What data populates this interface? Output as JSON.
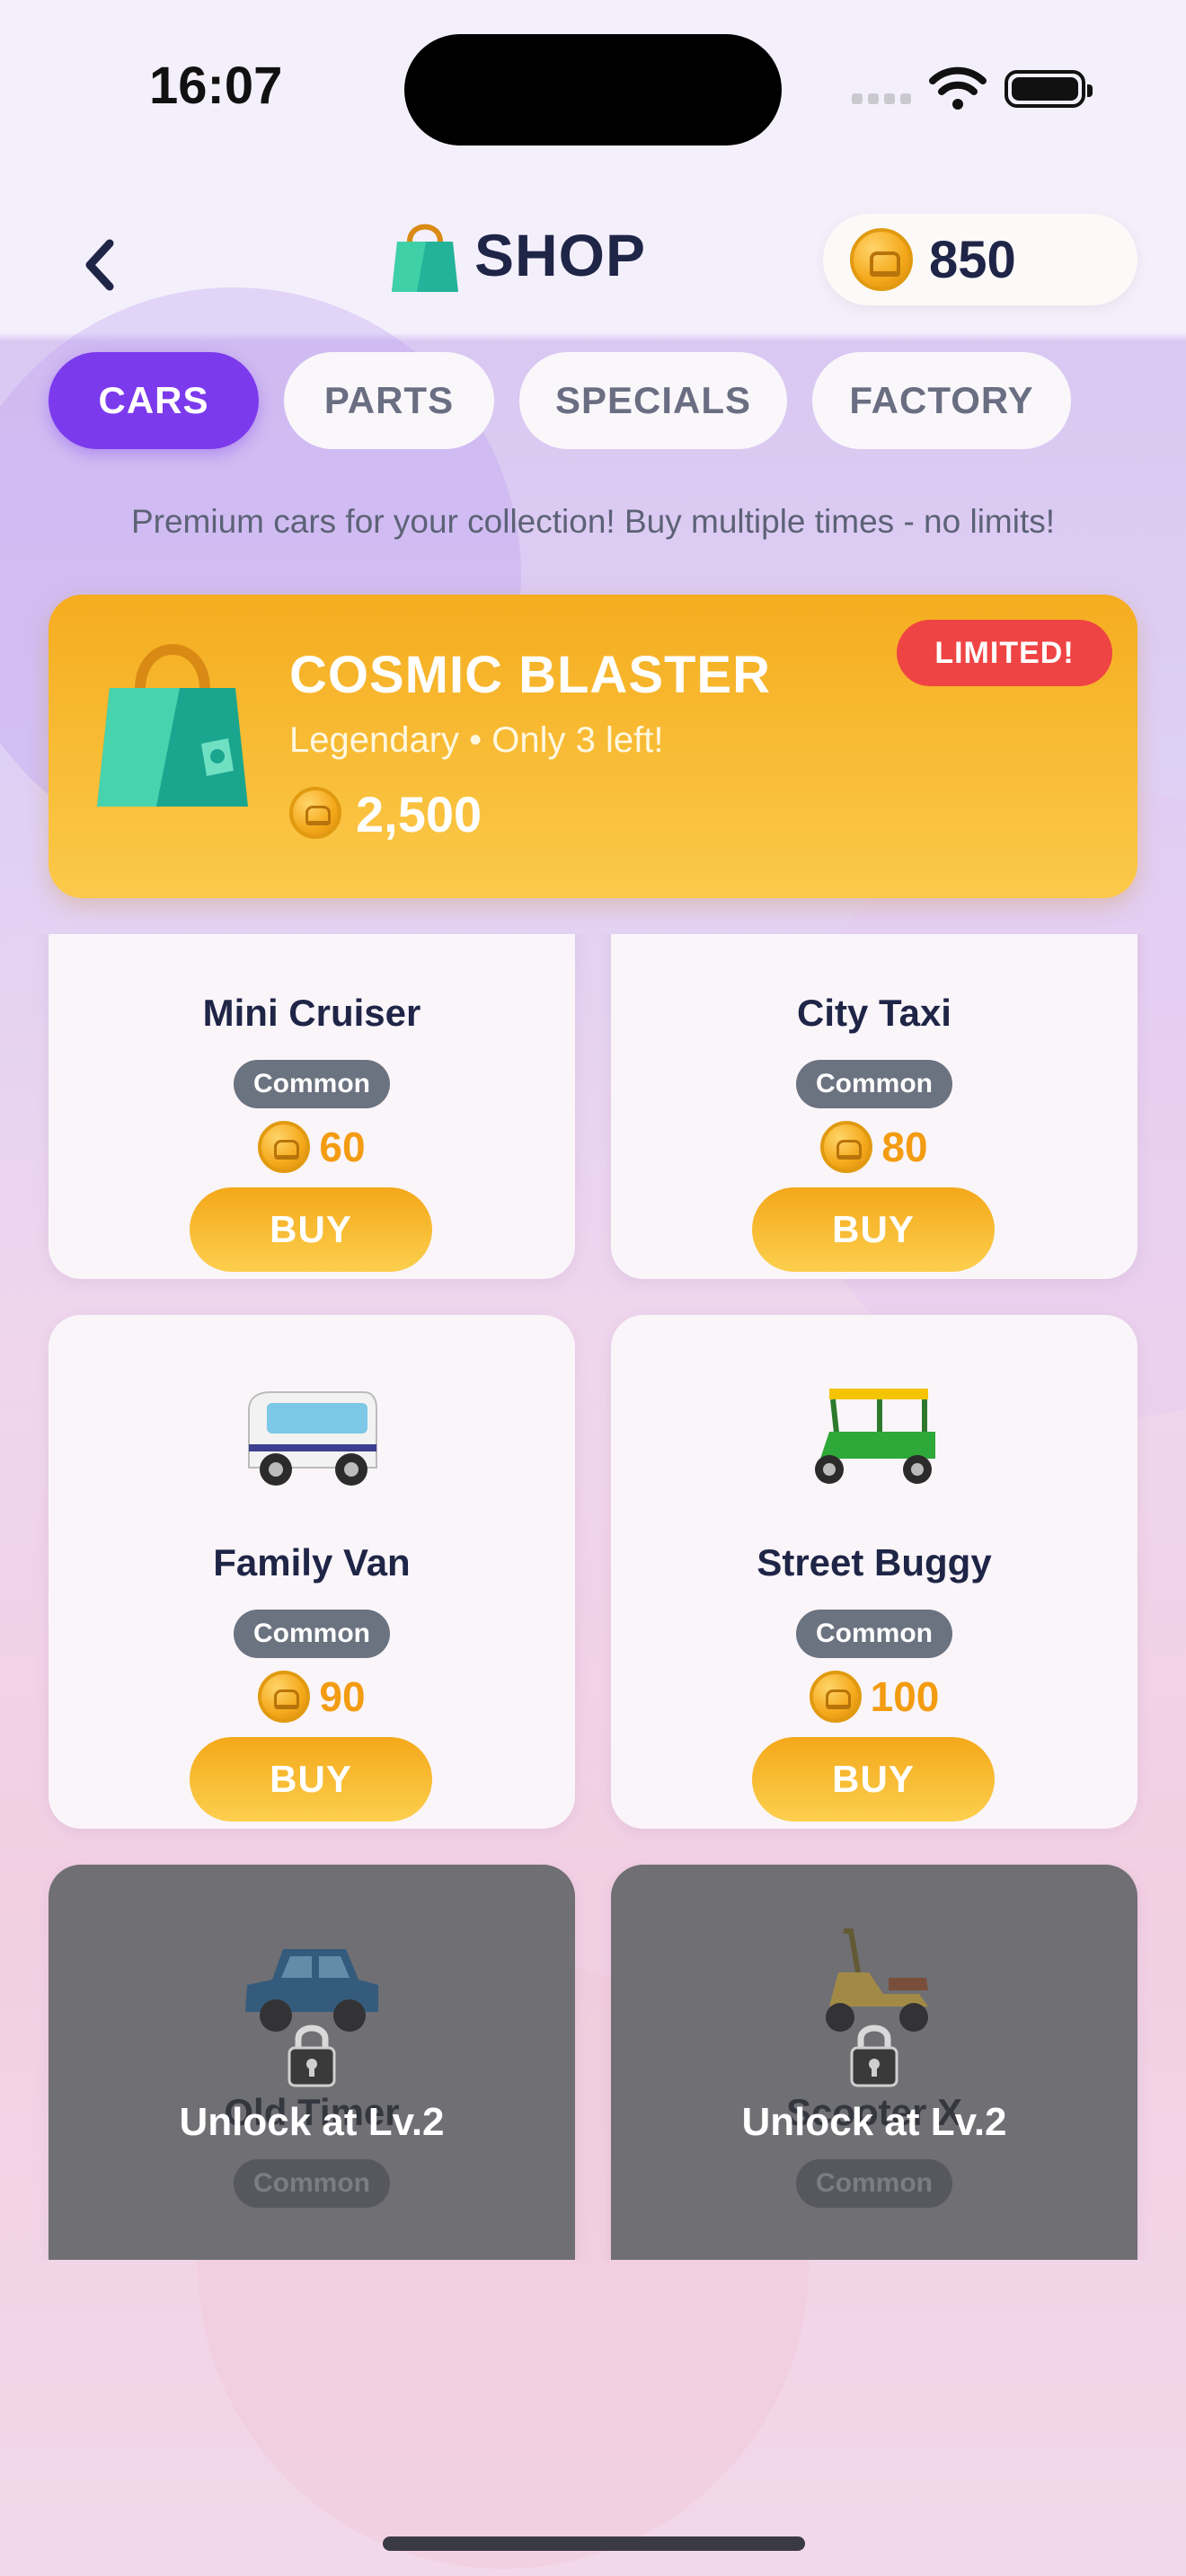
{
  "status_bar": {
    "time": "16:07"
  },
  "header": {
    "title": "SHOP",
    "coins": "850"
  },
  "tabs": [
    {
      "label": "CARS",
      "active": true
    },
    {
      "label": "PARTS",
      "active": false
    },
    {
      "label": "SPECIALS",
      "active": false
    },
    {
      "label": "FACTORY",
      "active": false
    }
  ],
  "subtitle": "Premium cars for your collection! Buy multiple times - no limits!",
  "featured": {
    "name": "COSMIC BLASTER",
    "subtitle": "Legendary • Only 3 left!",
    "price": "2,500",
    "badge": "LIMITED!"
  },
  "cards": [
    {
      "name": "Mini Cruiser",
      "rarity": "Common",
      "price": "60",
      "buy_label": "BUY",
      "icon": "red-car-icon",
      "locked": false
    },
    {
      "name": "City Taxi",
      "rarity": "Common",
      "price": "80",
      "buy_label": "BUY",
      "icon": "taxi-icon",
      "locked": false
    },
    {
      "name": "Family Van",
      "rarity": "Common",
      "price": "90",
      "buy_label": "BUY",
      "icon": "van-icon",
      "locked": false
    },
    {
      "name": "Street Buggy",
      "rarity": "Common",
      "price": "100",
      "buy_label": "BUY",
      "icon": "rickshaw-icon",
      "locked": false
    },
    {
      "name": "Old Timer",
      "rarity": "Common",
      "price": "",
      "locked": true,
      "lock_label": "Unlock at Lv.2",
      "icon": "old-car-icon"
    },
    {
      "name": "Scooter X",
      "rarity": "Common",
      "price": "",
      "locked": true,
      "lock_label": "Unlock at Lv.2",
      "icon": "scooter-icon"
    }
  ],
  "colors": {
    "accent": "#7c3aed",
    "gold": "#f5ad1f",
    "limited": "#ef4444",
    "rarity_common": "#6b7280"
  }
}
